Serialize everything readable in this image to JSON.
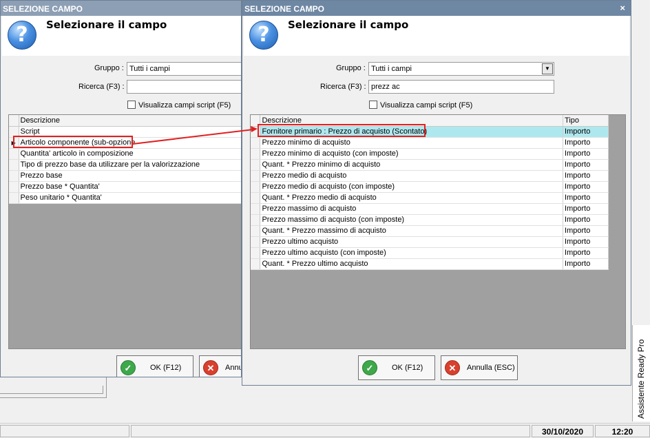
{
  "dialog_back": {
    "title": "SELEZIONE CAMPO",
    "header_title": "Selezionare il campo",
    "gruppo_label": "Gruppo :",
    "gruppo_value": "Tutti i campi",
    "ricerca_label": "Ricerca (F3) :",
    "ricerca_value": "",
    "checkbox_label": "Visualizza campi script (F5)",
    "grid_header": "Descrizione",
    "rows": [
      "Script",
      "Articolo componente (sub-opzione",
      "Quantita' articolo in composizione",
      "Tipo di prezzo base da utilizzare per la valorizzazione",
      "Prezzo base",
      "Prezzo base * Quantita'",
      "Peso unitario * Quantita'"
    ],
    "ok_label": "OK (F12)",
    "cancel_label": "Annu"
  },
  "dialog_front": {
    "title": "SELEZIONE CAMPO",
    "close_glyph": "×",
    "header_title": "Selezionare il campo",
    "gruppo_label": "Gruppo :",
    "gruppo_value": "Tutti i campi",
    "ricerca_label": "Ricerca (F3) :",
    "ricerca_value": "prezz ac",
    "checkbox_label": "Visualizza campi script (F5)",
    "col_descrizione": "Descrizione",
    "col_tipo": "Tipo",
    "rows": [
      {
        "desc": "Fornitore primario : Prezzo di acquisto (Scontato)",
        "tipo": "Importo"
      },
      {
        "desc": "Prezzo minimo di acquisto",
        "tipo": "Importo"
      },
      {
        "desc": "Prezzo minimo di acquisto (con imposte)",
        "tipo": "Importo"
      },
      {
        "desc": "Quant. * Prezzo minimo di acquisto",
        "tipo": "Importo"
      },
      {
        "desc": "Prezzo medio di acquisto",
        "tipo": "Importo"
      },
      {
        "desc": "Prezzo medio di acquisto (con imposte)",
        "tipo": "Importo"
      },
      {
        "desc": "Quant. * Prezzo medio di acquisto",
        "tipo": "Importo"
      },
      {
        "desc": "Prezzo massimo di acquisto",
        "tipo": "Importo"
      },
      {
        "desc": "Prezzo massimo di acquisto (con imposte)",
        "tipo": "Importo"
      },
      {
        "desc": "Quant. * Prezzo massimo di acquisto",
        "tipo": "Importo"
      },
      {
        "desc": "Prezzo ultimo acquisto",
        "tipo": "Importo"
      },
      {
        "desc": "Prezzo ultimo acquisto (con imposte)",
        "tipo": "Importo"
      },
      {
        "desc": "Quant. * Prezzo ultimo acquisto",
        "tipo": "Importo"
      }
    ],
    "ok_label": "OK (F12)",
    "cancel_label": "Annulla (ESC)"
  },
  "side_panel_label": "Assistente Ready Pro",
  "statusbar": {
    "date": "30/10/2020",
    "time": "12:20"
  },
  "colors": {
    "title_active": "#6e87a3",
    "title_inactive": "#8d9fb4",
    "selected_row": "#aee8ef",
    "highlight": "#e02020"
  },
  "icons": [
    "question-icon",
    "ok-check-icon",
    "cancel-x-icon",
    "dropdown-arrow-icon",
    "close-icon",
    "row-indicator-icon"
  ]
}
